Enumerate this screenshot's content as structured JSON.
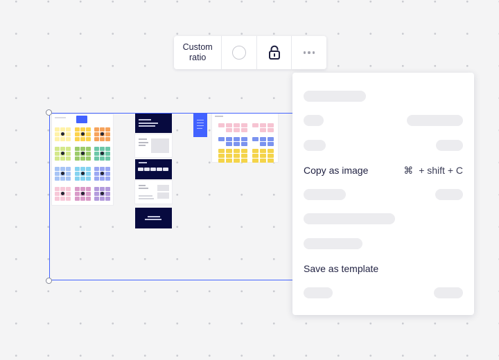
{
  "toolbar": {
    "ratio_label_line1": "Custom",
    "ratio_label_line2": "ratio",
    "shape_icon": "circle-icon",
    "lock_icon": "unlock-icon",
    "more_icon": "more-dots-icon"
  },
  "context_menu": {
    "copy_as_image": {
      "label": "Copy as image",
      "shortcut_symbol": "⌘",
      "shortcut_keys": "+ shift + C"
    },
    "save_as_template": {
      "label": "Save as template"
    }
  },
  "colors": {
    "accent": "#4262ff",
    "canvas": "#f4f4f5",
    "text": "#1f2041",
    "placeholder": "#ececef",
    "dark_board": "#070a3f"
  }
}
